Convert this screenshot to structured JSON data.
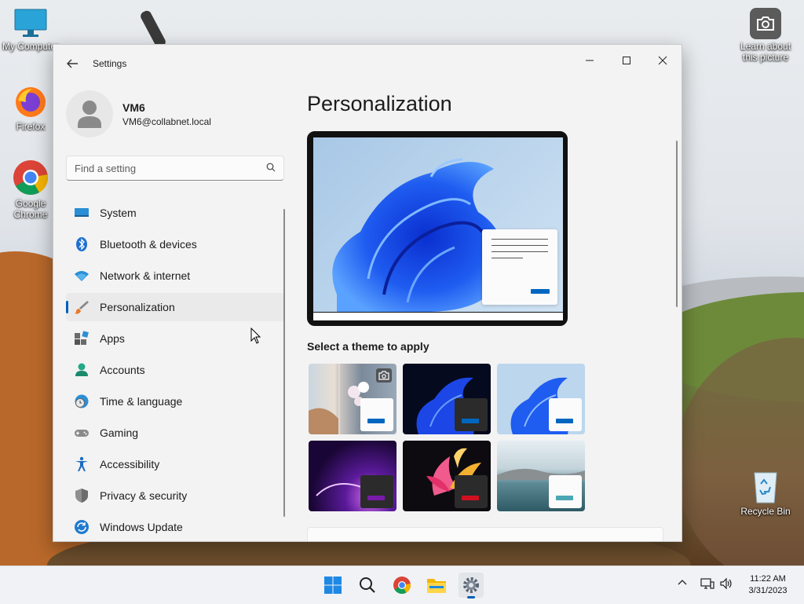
{
  "desktop": {
    "icons": [
      {
        "label": "My Computer"
      },
      {
        "label": "Firefox"
      },
      {
        "label": "Google Chrome"
      },
      {
        "label": "Learn about this picture"
      },
      {
        "label": "Recycle Bin"
      }
    ]
  },
  "window": {
    "title": "Settings",
    "user": {
      "name": "VM6",
      "email": "VM6@collabnet.local"
    },
    "search": {
      "placeholder": "Find a setting"
    },
    "nav": [
      {
        "label": "System",
        "icon": "system-icon"
      },
      {
        "label": "Bluetooth & devices",
        "icon": "bluetooth-icon"
      },
      {
        "label": "Network & internet",
        "icon": "wifi-icon"
      },
      {
        "label": "Personalization",
        "icon": "brush-icon",
        "selected": true
      },
      {
        "label": "Apps",
        "icon": "apps-icon"
      },
      {
        "label": "Accounts",
        "icon": "person-icon"
      },
      {
        "label": "Time & language",
        "icon": "clock-globe-icon"
      },
      {
        "label": "Gaming",
        "icon": "gamepad-icon"
      },
      {
        "label": "Accessibility",
        "icon": "accessibility-icon"
      },
      {
        "label": "Privacy & security",
        "icon": "shield-icon"
      },
      {
        "label": "Windows Update",
        "icon": "update-icon"
      }
    ],
    "page": {
      "title": "Personalization",
      "themes_heading": "Select a theme to apply",
      "themes": [
        {
          "name": "spotlight",
          "accent": "#0067c0"
        },
        {
          "name": "windows-dark",
          "accent": "#0067c0"
        },
        {
          "name": "windows-light",
          "accent": "#0067c0"
        },
        {
          "name": "glow",
          "accent": "#7a1aa8"
        },
        {
          "name": "captured-motion",
          "accent": "#d01020"
        },
        {
          "name": "flow",
          "accent": "#4aa7b4"
        }
      ]
    }
  },
  "taskbar": {
    "apps": [
      "start-icon",
      "search-icon",
      "chrome-icon",
      "file-explorer-icon",
      "settings-icon"
    ],
    "clock": {
      "time": "11:22 AM",
      "date": "3/31/2023"
    }
  },
  "colors": {
    "accent": "#005fb8",
    "window_bg": "#f3f3f3"
  }
}
